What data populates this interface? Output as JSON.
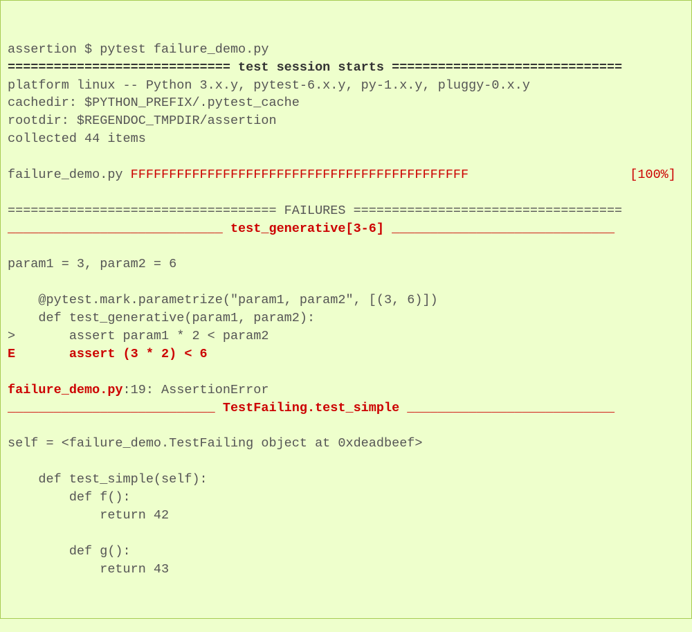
{
  "lines": [
    {
      "segments": [
        {
          "cls": "gray",
          "text": "assertion $ pytest failure_demo.py"
        }
      ]
    },
    {
      "segments": [
        {
          "cls": "bold",
          "text": "============================= test session starts =============================="
        }
      ]
    },
    {
      "segments": [
        {
          "cls": "gray",
          "text": "platform linux -- Python 3.x.y, pytest-6.x.y, py-1.x.y, pluggy-0.x.y"
        }
      ]
    },
    {
      "segments": [
        {
          "cls": "gray",
          "text": "cachedir: $PYTHON_PREFIX/.pytest_cache"
        }
      ]
    },
    {
      "segments": [
        {
          "cls": "gray",
          "text": "rootdir: $REGENDOC_TMPDIR/assertion"
        }
      ]
    },
    {
      "segments": [
        {
          "cls": "gray",
          "text": "collected 44 items"
        }
      ]
    },
    {
      "segments": [
        {
          "cls": "gray",
          "text": ""
        }
      ]
    },
    {
      "segments": [
        {
          "cls": "gray",
          "text": "failure_demo.py "
        },
        {
          "cls": "red",
          "text": "FFFFFFFFFFFFFFFFFFFFFFFFFFFFFFFFFFFFFFFFFFFF                     [100%]"
        }
      ]
    },
    {
      "segments": [
        {
          "cls": "gray",
          "text": ""
        }
      ]
    },
    {
      "segments": [
        {
          "cls": "gray",
          "text": "=================================== FAILURES ==================================="
        }
      ]
    },
    {
      "segments": [
        {
          "cls": "redbold",
          "text": "____________________________ test_generative[3-6] _____________________________"
        }
      ]
    },
    {
      "segments": [
        {
          "cls": "gray",
          "text": ""
        }
      ]
    },
    {
      "segments": [
        {
          "cls": "gray",
          "text": "param1 = 3, param2 = 6"
        }
      ]
    },
    {
      "segments": [
        {
          "cls": "gray",
          "text": ""
        }
      ]
    },
    {
      "segments": [
        {
          "cls": "gray",
          "text": "    @pytest.mark.parametrize(\"param1, param2\", [(3, 6)])"
        }
      ]
    },
    {
      "segments": [
        {
          "cls": "gray",
          "text": "    def test_generative(param1, param2):"
        }
      ]
    },
    {
      "segments": [
        {
          "cls": "gray",
          "text": ">       assert param1 * 2 < param2"
        }
      ]
    },
    {
      "segments": [
        {
          "cls": "redbold",
          "text": "E       assert (3 * 2) < 6"
        }
      ]
    },
    {
      "segments": [
        {
          "cls": "gray",
          "text": ""
        }
      ]
    },
    {
      "segments": [
        {
          "cls": "redbold",
          "text": "failure_demo.py"
        },
        {
          "cls": "gray",
          "text": ":19: AssertionError"
        }
      ]
    },
    {
      "segments": [
        {
          "cls": "redbold",
          "text": "___________________________ TestFailing.test_simple ___________________________"
        }
      ]
    },
    {
      "segments": [
        {
          "cls": "gray",
          "text": ""
        }
      ]
    },
    {
      "segments": [
        {
          "cls": "gray",
          "text": "self = <failure_demo.TestFailing object at 0xdeadbeef>"
        }
      ]
    },
    {
      "segments": [
        {
          "cls": "gray",
          "text": ""
        }
      ]
    },
    {
      "segments": [
        {
          "cls": "gray",
          "text": "    def test_simple(self):"
        }
      ]
    },
    {
      "segments": [
        {
          "cls": "gray",
          "text": "        def f():"
        }
      ]
    },
    {
      "segments": [
        {
          "cls": "gray",
          "text": "            return 42"
        }
      ]
    },
    {
      "segments": [
        {
          "cls": "gray",
          "text": ""
        }
      ]
    },
    {
      "segments": [
        {
          "cls": "gray",
          "text": "        def g():"
        }
      ]
    },
    {
      "segments": [
        {
          "cls": "gray",
          "text": "            return 43"
        }
      ]
    }
  ]
}
